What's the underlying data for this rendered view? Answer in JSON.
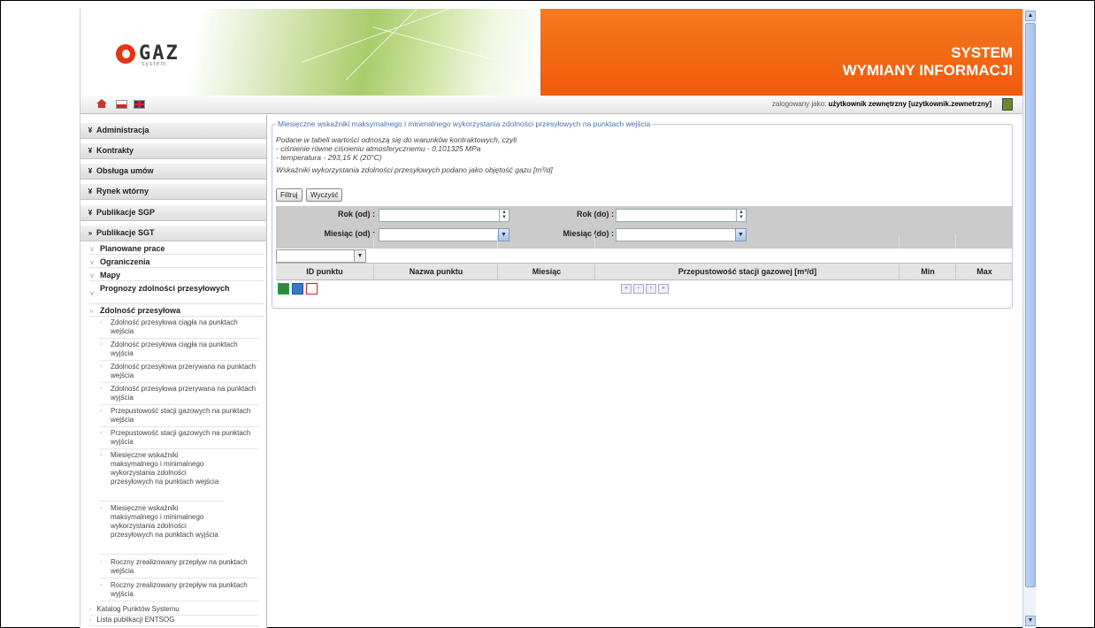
{
  "header": {
    "logo_text": "GAZ",
    "logo_sub": "system",
    "title_line1": "SYSTEM",
    "title_line2": "WYMIANY INFORMACJI"
  },
  "toolbar": {
    "login_prefix": "zalogowany jako:",
    "login_user": "użytkownik zewnętrzny [uzytkownik.zewnetrzny]"
  },
  "sidebar": {
    "sections": [
      {
        "label": "Administracja"
      },
      {
        "label": "Kontrakty"
      },
      {
        "label": "Obsługa umów"
      },
      {
        "label": "Rynek wtórny"
      },
      {
        "label": "Publikacje SGP"
      },
      {
        "label": "Publikacje SGT"
      }
    ],
    "sgt_items": [
      {
        "label": "Planowane prace"
      },
      {
        "label": "Ograniczenia"
      },
      {
        "label": "Mapy"
      },
      {
        "label": "Prognozy zdolności przesyłowych"
      },
      {
        "label": "Zdolność przesyłowa"
      }
    ],
    "leaves": [
      {
        "label": "Zdolność przesyłowa ciągła na punktach wejścia"
      },
      {
        "label": "Zdolność przesyłowa ciągła na punktach wyjścia"
      },
      {
        "label": "Zdolność przesyłowa przerywana na punktach wejścia"
      },
      {
        "label": "Zdolność przesyłowa przerywana na punktach wyjścia"
      },
      {
        "label": "Przepustowość stacji gazowych na punktach wejścia"
      },
      {
        "label": "Przepustowość stacji gazowych na punktach wyjścia"
      },
      {
        "label": "Miesięczne wskaźniki maksymalnego i minimalnego wykorzystania zdolności przesyłowych na punktach wejścia"
      },
      {
        "label": "Miesięczne wskaźniki maksymalnego i minimalnego wykorzystania zdolności przesyłowych na punktach wyjścia"
      },
      {
        "label": "Roczny zrealizowany przepływ na punktach wejścia"
      },
      {
        "label": "Roczny zrealizowany przepływ na punktach wyjścia"
      }
    ],
    "bottom_items": [
      {
        "label": "Katalog Punktów Systemu"
      },
      {
        "label": "Lista publikacji ENTSOG"
      }
    ]
  },
  "main": {
    "legend": "Miesięczne wskaźniki maksymalnego i minimalnego wykorzystania zdolności przesyłowych na punktach wejścia",
    "info1": "Podane w tabeli wartości odnoszą się do warunków kontraktowych, czyli",
    "info2": "- ciśnienie równe ciśnieniu atmosferycznemu - 0,101325 MPa",
    "info3": "- temperatura - 293,15 K (20°C)",
    "info4": "Wskaźniki wykorzystania zdolności przesyłowych podano jako objętość gazu [m³/d]",
    "filter_button": "Filtruj",
    "clear_button": "Wyczyść",
    "year_from_label": "Rok (od) :",
    "year_to_label": "Rok (do) :",
    "month_from_label": "Miesiąc (od) :",
    "month_to_label": "Miesiąc (do) :",
    "year_from_value": "",
    "year_to_value": "",
    "month_from_value": "",
    "month_to_value": "",
    "columns": [
      "ID punktu",
      "Nazwa punktu",
      "Miesiąc",
      "Przepustowość stacji gazowej [m³/d]",
      "Min",
      "Max"
    ]
  },
  "colors": {
    "banner_orange": "#f05a0c",
    "legend_blue": "#4a6fb0",
    "filter_bg": "#cbcbcb"
  }
}
